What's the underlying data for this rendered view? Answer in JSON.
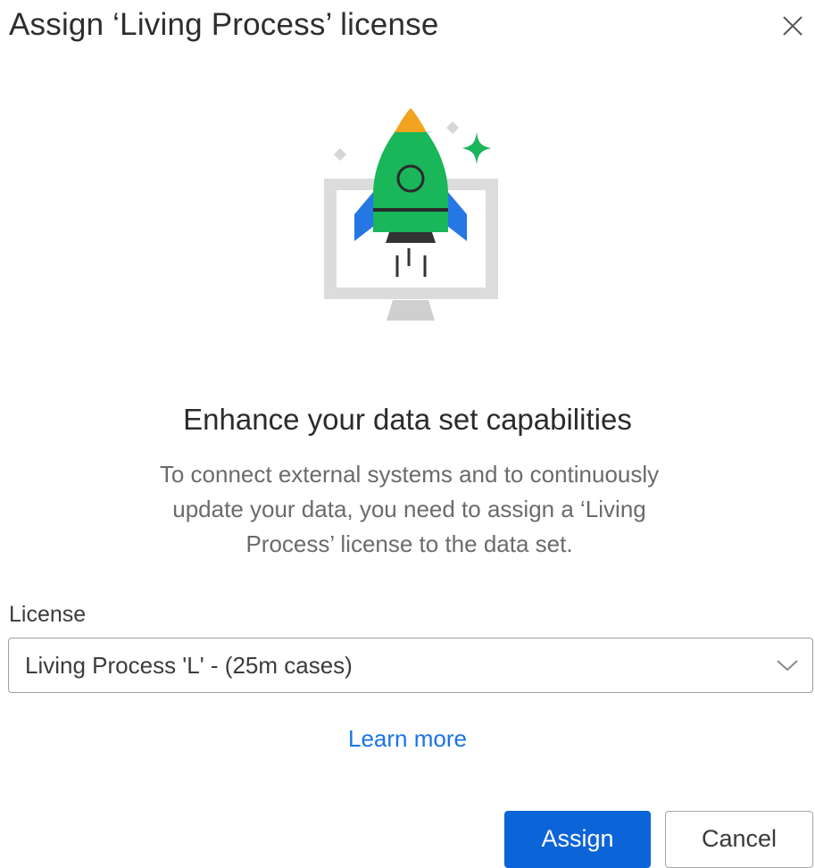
{
  "dialog": {
    "title": "Assign ‘Living Process’ license",
    "close_icon": "close-icon"
  },
  "illustration": {
    "icon": "rocket-monitor-illustration",
    "colors": {
      "rocket_body": "#19b65a",
      "rocket_nose": "#f2a31f",
      "rocket_fins": "#2577e6",
      "sparkle": "#19b65a",
      "monitor": "#dcdcdc",
      "dark": "#333333"
    }
  },
  "content": {
    "heading": "Enhance your data set capabilities",
    "description": "To connect external systems and to continuously update your data, you need to assign a ‘Living Process’ license to the data set."
  },
  "license_field": {
    "label": "License",
    "selected_value": "Living Process 'L' - (25m cases)",
    "icon": "chevron-down-icon"
  },
  "learn_more": {
    "label": "Learn more",
    "color": "#1a73e8"
  },
  "actions": {
    "assign_label": "Assign",
    "cancel_label": "Cancel",
    "primary_color": "#0b64d8"
  }
}
